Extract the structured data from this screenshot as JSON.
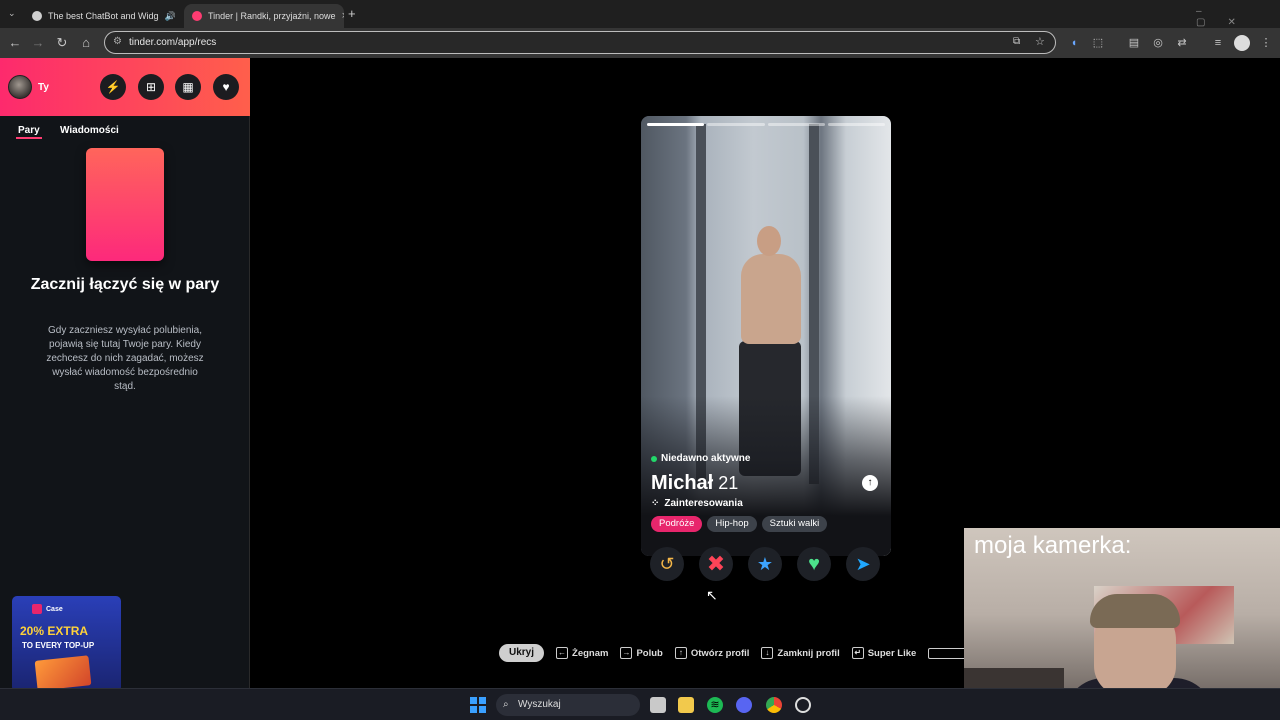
{
  "browser": {
    "tabs": [
      {
        "title": "The best ChatBot and Widg",
        "active": false
      },
      {
        "title": "Tinder | Randki, przyjaźni, nowe",
        "active": true
      }
    ],
    "url": "tinder.com/app/recs",
    "new_tab": "+",
    "close_glyph": "×"
  },
  "sidebar": {
    "user": "Ty",
    "tabs": [
      "Pary",
      "Wiadomości"
    ],
    "empty_title": "Zacznij łączyć się w pary",
    "empty_desc": "Gdy zaczniesz wysyłać polubienia, pojawią się tutaj Twoje pary. Kiedy zechcesz do nich zagadać, możesz wysłać wiadomość bezpośrednio stąd.",
    "ad": {
      "brand": "Case",
      "line1": "20% EXTRA",
      "line2": "TO EVERY TOP-UP"
    }
  },
  "profile": {
    "status": "Niedawno aktywne",
    "name": "Michał",
    "age": "21",
    "interests_label": "Zainteresowania",
    "interests": [
      "Podróże",
      "Hip-hop",
      "Sztuki walki"
    ]
  },
  "hotkeys": {
    "hide": "Ukryj",
    "nope": "Żegnam",
    "like": "Polub",
    "open_profile": "Otwórz profil",
    "close_profile": "Zamknij profil",
    "super_like": "Super Like"
  },
  "webcam": {
    "label": "moja kamerka:"
  },
  "taskbar": {
    "search_placeholder": "Wyszukaj"
  },
  "colors": {
    "accent": "#fe3c72",
    "like": "#4ce28b",
    "nope": "#ff4458",
    "super": "#3ca4ff",
    "rewind": "#f5b748",
    "boost": "#20a8ff"
  }
}
